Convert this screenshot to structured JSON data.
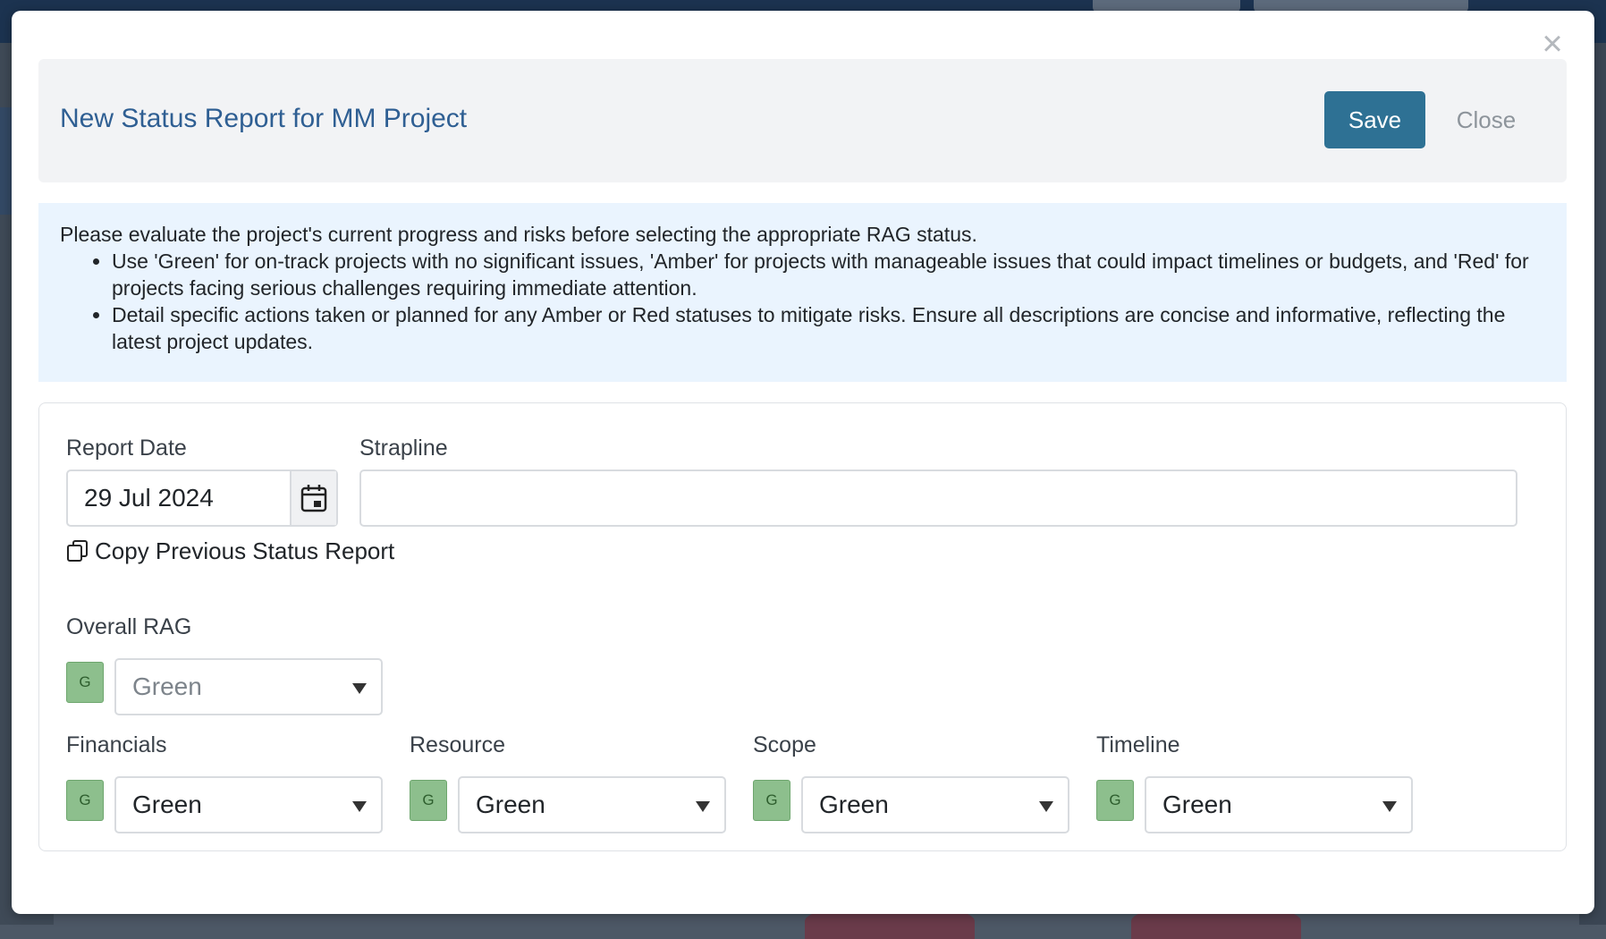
{
  "modal": {
    "title": "New Status Report for MM Project",
    "save_label": "Save",
    "close_label": "Close",
    "close_x": "×"
  },
  "guidance": {
    "intro": "Please evaluate the project's current progress and risks before selecting the appropriate RAG status.",
    "bullets": [
      "Use 'Green' for on-track projects with no significant issues, 'Amber' for projects with manageable issues that could impact timelines or budgets, and 'Red' for projects facing serious challenges requiring immediate attention.",
      "Detail specific actions taken or planned for any Amber or Red statuses to mitigate risks. Ensure all descriptions are concise and informative, reflecting the latest project updates."
    ]
  },
  "form": {
    "report_date_label": "Report Date",
    "report_date_value": "29 Jul 2024",
    "strapline_label": "Strapline",
    "strapline_value": "",
    "copy_previous_label": "Copy Previous Status Report",
    "overall_rag": {
      "label": "Overall RAG",
      "badge": "G",
      "value": "Green"
    },
    "financials": {
      "label": "Financials",
      "badge": "G",
      "value": "Green"
    },
    "resource": {
      "label": "Resource",
      "badge": "G",
      "value": "Green"
    },
    "scope": {
      "label": "Scope",
      "badge": "G",
      "value": "Green"
    },
    "timeline": {
      "label": "Timeline",
      "badge": "G",
      "value": "Green"
    }
  },
  "colors": {
    "primary_button": "#2e7194",
    "title_text": "#2f5f93",
    "rag_green": "#8dbf8d",
    "guidance_bg": "#eaf4fe"
  },
  "icons": {
    "calendar": "calendar-icon",
    "copy": "copy-icon",
    "close": "close-icon",
    "dropdown": "chevron-down-icon"
  }
}
